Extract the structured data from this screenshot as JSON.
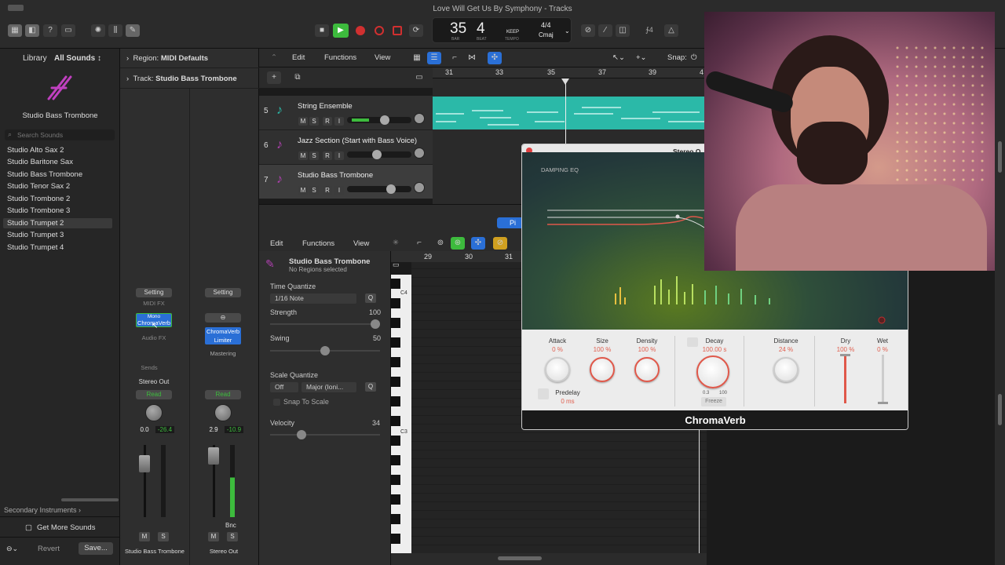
{
  "window": {
    "title": "Love Will Get Us By Symphony - Tracks"
  },
  "transport": {
    "bar": "35",
    "beat": "4",
    "bar_label": "BAR",
    "beat_label": "BEAT",
    "keep": "KEEP",
    "tempo_label": "TEMPO",
    "signature": "4/4",
    "key": "Cmaj",
    "count_in": "∱4"
  },
  "library": {
    "title": "Library",
    "filter": "All Sounds ↕",
    "patch_name": "Studio Bass Trombone",
    "search_placeholder": "Search Sounds",
    "items": [
      "Studio Alto Sax 2",
      "Studio Baritone Sax",
      "Studio Bass Trombone",
      "Studio Tenor Sax 2",
      "Studio Trombone 2",
      "Studio Trombone 3",
      "Studio Trumpet 2",
      "Studio Trumpet 3",
      "Studio Trumpet 4"
    ],
    "secondary": "Secondary Instruments ›",
    "get_more": "Get More Sounds",
    "revert": "Revert",
    "save": "Save..."
  },
  "inspector": {
    "region_label": "Region:",
    "region_value": "MIDI Defaults",
    "track_label": "Track:",
    "track_value": "Studio Bass Trombone",
    "strip1": {
      "setting": "Setting",
      "midi_fx": "MIDI FX",
      "inst1": "Mono",
      "inst2": "ChromaVerb",
      "audio_fx": "Audio FX",
      "sends": "Sends",
      "output": "Stereo Out",
      "automation": "Read",
      "vol": "0.0",
      "peak": "-26.4",
      "m": "M",
      "s": "S",
      "name": "Studio Bass Trombone"
    },
    "strip2": {
      "setting": "Setting",
      "fx1": "ChromaVerb",
      "fx2": "Limiter",
      "mastering": "Mastering",
      "automation": "Read",
      "vol": "2.9",
      "peak": "-10.9",
      "bnc": "Bnc",
      "m": "M",
      "s": "S",
      "name": "Stereo Out"
    }
  },
  "tracks_menu": {
    "edit": "Edit",
    "functions": "Functions",
    "view": "View",
    "snap": "Snap:"
  },
  "ruler": [
    "31",
    "33",
    "35",
    "37",
    "39",
    "4"
  ],
  "tracks": [
    {
      "num": "5",
      "name": "String Ensemble"
    },
    {
      "num": "6",
      "name": "Jazz Section (Start with Bass Voice)"
    },
    {
      "num": "7",
      "name": "Studio Bass Trombone"
    }
  ],
  "track_buttons": {
    "m": "M",
    "s": "S",
    "r": "R",
    "i": "I"
  },
  "editor": {
    "edit": "Edit",
    "functions": "Functions",
    "view": "View",
    "region_name": "Studio Bass Trombone",
    "region_sub": "No Regions selected",
    "time_quantize": "Time Quantize",
    "tq_value": "1/16 Note",
    "q": "Q",
    "strength_label": "Strength",
    "strength": "100",
    "swing_label": "Swing",
    "swing": "50",
    "scale_quantize": "Scale Quantize",
    "sq_off": "Off",
    "sq_mode": "Major (Ioni...",
    "snap_to_scale": "Snap To Scale",
    "velocity_label": "Velocity",
    "velocity": "34",
    "ruler": [
      "29",
      "30",
      "31"
    ],
    "c4": "C4",
    "c3": "C3",
    "tab": "Pi"
  },
  "plugin": {
    "title": "Stereo O",
    "damping": "DAMPING EQ",
    "footer": "ChromaVerb",
    "attack": {
      "label": "Attack",
      "value": "0 %"
    },
    "size": {
      "label": "Size",
      "value": "100 %"
    },
    "density": {
      "label": "Density",
      "value": "100 %"
    },
    "decay": {
      "label": "Decay",
      "value": "100.00 s",
      "min": "0.3",
      "max": "100"
    },
    "distance": {
      "label": "Distance",
      "value": "24 %"
    },
    "dry": {
      "label": "Dry",
      "value": "100 %"
    },
    "wet": {
      "label": "Wet",
      "value": "0 %"
    },
    "predelay": {
      "label": "Predelay",
      "value": "0 ms"
    },
    "freeze": "Freeze"
  },
  "colors": {
    "accent": "#2bb9a8",
    "play": "#3dbb3d",
    "record": "#d03030",
    "plugin_red": "#e0584a",
    "selected_blue": "#2a6fd6"
  }
}
